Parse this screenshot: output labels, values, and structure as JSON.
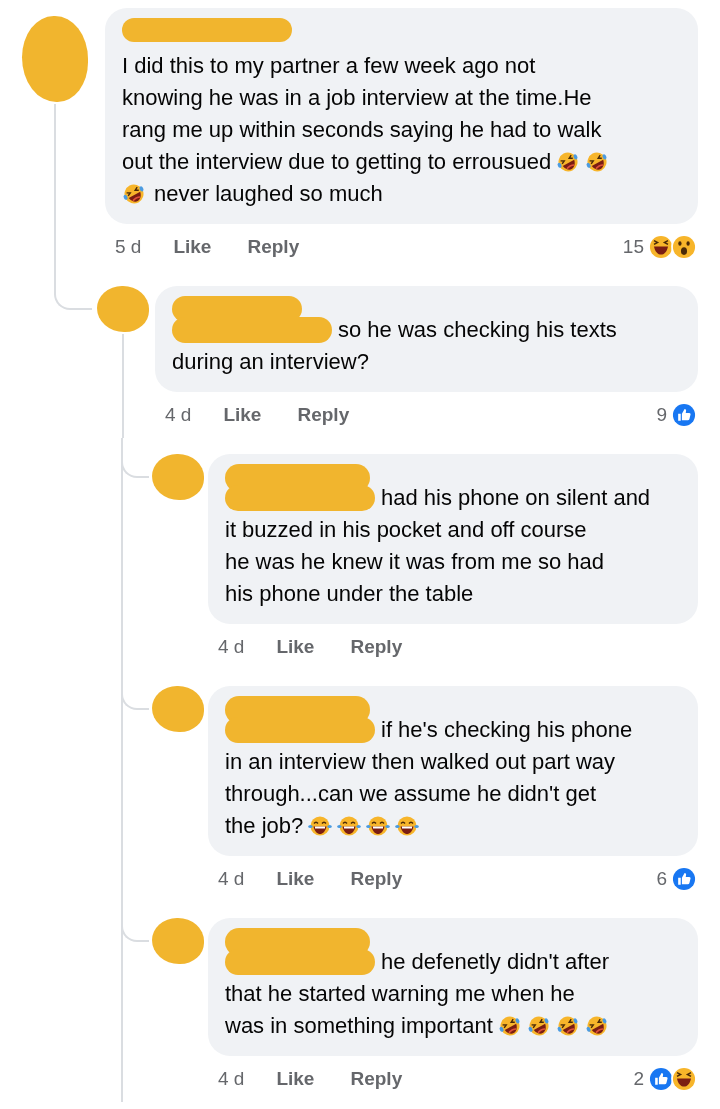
{
  "comments": [
    {
      "name_redacted": true,
      "time": "5 d",
      "like": "Like",
      "reply": "Reply",
      "reaction_count": "15",
      "reactions": [
        {
          "kind": "haha"
        },
        {
          "kind": "wow"
        }
      ],
      "lines": [
        [
          {
            "kind": "text",
            "text": "I did this to my partner a few week ago not"
          }
        ],
        [
          {
            "kind": "text",
            "text": "knowing he was in a job interview at the time.He"
          }
        ],
        [
          {
            "kind": "text",
            "text": "rang me up within seconds saying he had to walk"
          }
        ],
        [
          {
            "kind": "text",
            "text": "out the interview due to getting to errousued"
          },
          {
            "kind": "rofl"
          },
          {
            "kind": "rofl"
          }
        ],
        [
          {
            "kind": "rofl"
          },
          {
            "kind": "text",
            "text": "never laughed so much"
          }
        ]
      ],
      "children": [
        {
          "name_redacted": true,
          "time": "4 d",
          "like": "Like",
          "reply": "Reply",
          "reaction_count": "9",
          "reactions": [
            {
              "kind": "like"
            }
          ],
          "lines": [
            [
              {
                "kind": "mention"
              },
              {
                "kind": "text",
                "text": "so he was checking his texts"
              }
            ],
            [
              {
                "kind": "text",
                "text": "during an interview?"
              }
            ]
          ],
          "children": [
            {
              "name_redacted": true,
              "time": "4 d",
              "like": "Like",
              "reply": "Reply",
              "lines": [
                [
                  {
                    "kind": "mention"
                  },
                  {
                    "kind": "text",
                    "text": "had his phone on silent and"
                  }
                ],
                [
                  {
                    "kind": "text",
                    "text": "it buzzed in his pocket and off course"
                  }
                ],
                [
                  {
                    "kind": "text",
                    "text": "he was he knew it was from me so had"
                  }
                ],
                [
                  {
                    "kind": "text",
                    "text": "his phone under the table"
                  }
                ]
              ]
            },
            {
              "name_redacted": true,
              "time": "4 d",
              "like": "Like",
              "reply": "Reply",
              "reaction_count": "6",
              "reactions": [
                {
                  "kind": "like"
                }
              ],
              "lines": [
                [
                  {
                    "kind": "mention"
                  },
                  {
                    "kind": "text",
                    "text": "if he's checking his phone"
                  }
                ],
                [
                  {
                    "kind": "text",
                    "text": "in an interview then walked out part way"
                  }
                ],
                [
                  {
                    "kind": "text",
                    "text": "through...can we assume he didn't get"
                  }
                ],
                [
                  {
                    "kind": "text",
                    "text": "the job?"
                  },
                  {
                    "kind": "joy"
                  },
                  {
                    "kind": "joy"
                  },
                  {
                    "kind": "joy"
                  },
                  {
                    "kind": "joy"
                  }
                ]
              ]
            },
            {
              "name_redacted": true,
              "time": "4 d",
              "like": "Like",
              "reply": "Reply",
              "reaction_count": "2",
              "reactions": [
                {
                  "kind": "like"
                },
                {
                  "kind": "haha"
                }
              ],
              "lines": [
                [
                  {
                    "kind": "mention"
                  },
                  {
                    "kind": "text",
                    "text": "he defenetly didn't after"
                  }
                ],
                [
                  {
                    "kind": "text",
                    "text": "that he started warning me when he"
                  }
                ],
                [
                  {
                    "kind": "text",
                    "text": "was in something important"
                  },
                  {
                    "kind": "rofl"
                  },
                  {
                    "kind": "rofl"
                  },
                  {
                    "kind": "rofl"
                  },
                  {
                    "kind": "rofl"
                  }
                ]
              ]
            }
          ]
        }
      ]
    }
  ]
}
